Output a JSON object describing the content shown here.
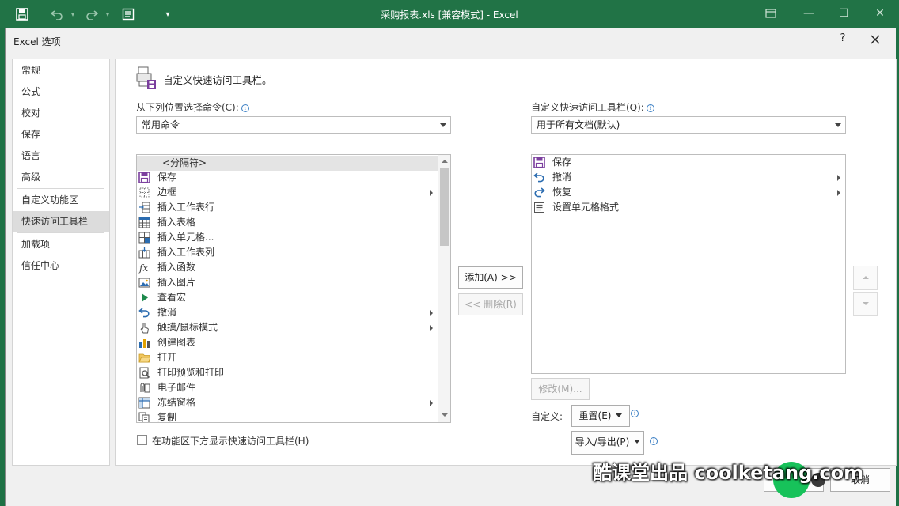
{
  "titlebar": {
    "title": "采购报表.xls  [兼容模式] - Excel"
  },
  "dialog": {
    "title": "Excel 选项",
    "help_label": "?"
  },
  "nav": {
    "items": [
      {
        "label": "常规"
      },
      {
        "label": "公式"
      },
      {
        "label": "校对"
      },
      {
        "label": "保存"
      },
      {
        "label": "语言"
      },
      {
        "label": "高级"
      },
      {
        "label": "自定义功能区"
      },
      {
        "label": "快速访问工具栏",
        "selected": true
      },
      {
        "label": "加载项"
      },
      {
        "label": "信任中心"
      }
    ]
  },
  "main": {
    "section_title": "自定义快速访问工具栏。",
    "choose_from_label": "从下列位置选择命令(C):",
    "choose_from_value": "常用命令",
    "customize_label": "自定义快速访问工具栏(Q):",
    "customize_value": "用于所有文档(默认)",
    "commands": [
      {
        "label": "<分隔符>",
        "icon": "separator-icon",
        "submenu": false
      },
      {
        "label": "保存",
        "icon": "save-icon",
        "submenu": false
      },
      {
        "label": "边框",
        "icon": "borders-icon",
        "submenu": true
      },
      {
        "label": "插入工作表行",
        "icon": "insert-row-icon",
        "submenu": false
      },
      {
        "label": "插入表格",
        "icon": "insert-table-icon",
        "submenu": false
      },
      {
        "label": "插入单元格...",
        "icon": "insert-cells-icon",
        "submenu": false
      },
      {
        "label": "插入工作表列",
        "icon": "insert-column-icon",
        "submenu": false
      },
      {
        "label": "插入函数",
        "icon": "function-icon",
        "submenu": false
      },
      {
        "label": "插入图片",
        "icon": "picture-icon",
        "submenu": false
      },
      {
        "label": "查看宏",
        "icon": "macro-play-icon",
        "submenu": false
      },
      {
        "label": "撤消",
        "icon": "undo-icon",
        "submenu": true
      },
      {
        "label": "触摸/鼠标模式",
        "icon": "touch-mode-icon",
        "submenu": true
      },
      {
        "label": "创建图表",
        "icon": "chart-icon",
        "submenu": false
      },
      {
        "label": "打开",
        "icon": "folder-open-icon",
        "submenu": false
      },
      {
        "label": "打印预览和打印",
        "icon": "print-preview-icon",
        "submenu": false
      },
      {
        "label": "电子邮件",
        "icon": "email-icon",
        "submenu": false
      },
      {
        "label": "冻结窗格",
        "icon": "freeze-panes-icon",
        "submenu": true
      },
      {
        "label": "复制",
        "icon": "copy-icon",
        "submenu": false
      }
    ],
    "toolbar_items": [
      {
        "label": "保存",
        "icon": "save-icon",
        "submenu": false
      },
      {
        "label": "撤消",
        "icon": "undo-icon",
        "submenu": true
      },
      {
        "label": "恢复",
        "icon": "redo-icon",
        "submenu": true
      },
      {
        "label": "设置单元格格式",
        "icon": "format-cells-icon",
        "submenu": false
      }
    ],
    "add_button": "添加(A) >>",
    "remove_button": "<< 删除(R)",
    "modify_button": "修改(M)...",
    "customize_short_label": "自定义:",
    "reset_button": "重置(E)",
    "import_export_button": "导入/导出(P)",
    "show_below_ribbon_label": "在功能区下方显示快速访问工具栏(H)"
  },
  "footer": {
    "cancel_label": "取消",
    "watermark": "酷课堂出品 coolketang.com"
  },
  "colors": {
    "excel_green": "#217346",
    "save_purple": "#7b3f9e",
    "undo_blue": "#2b6cb0"
  }
}
